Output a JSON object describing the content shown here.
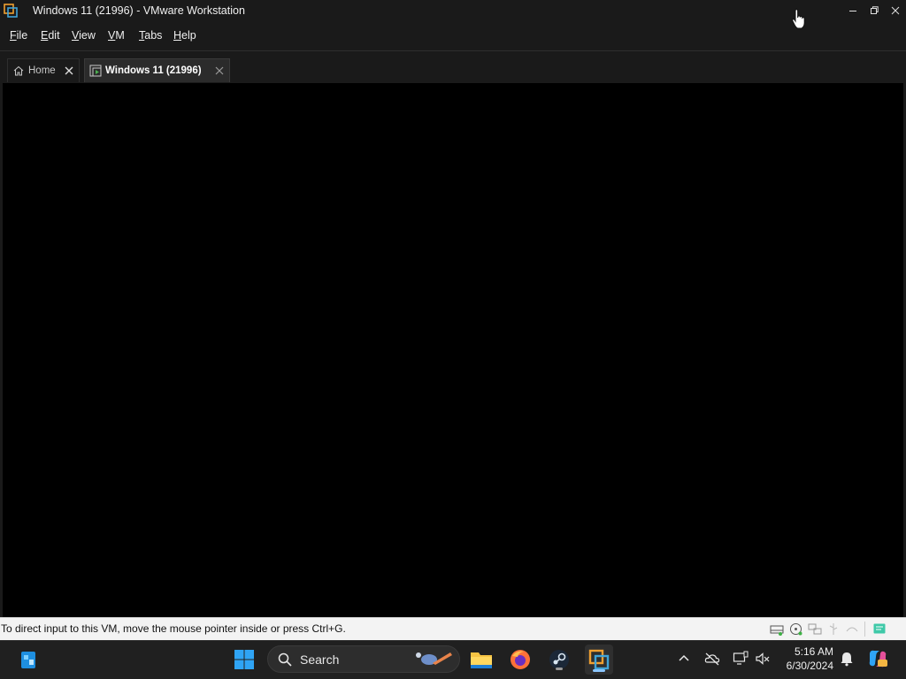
{
  "window": {
    "title": "Windows 11 (21996) - VMware Workstation"
  },
  "menu": {
    "items": [
      "File",
      "Edit",
      "View",
      "VM",
      "Tabs",
      "Help"
    ]
  },
  "tabs": [
    {
      "label": "Home",
      "active": false,
      "icon": "home-icon"
    },
    {
      "label": "Windows 11 (21996)",
      "active": true,
      "icon": "vm-icon"
    }
  ],
  "status": {
    "message": "To direct input to this VM, move the mouse pointer inside or press Ctrl+G.",
    "icons": [
      "hard-disk-icon",
      "cd-rom-icon",
      "network-icon",
      "usb-icon",
      "sound-icon",
      "message-icon"
    ]
  },
  "taskbar": {
    "search_placeholder": "Search",
    "pinned": [
      "start-icon",
      "search-icon",
      "file-explorer-icon",
      "firefox-icon",
      "steam-icon",
      "vmware-icon"
    ],
    "tray": [
      "chevron-up-icon",
      "onedrive-icon",
      "display-icon",
      "volume-icon"
    ],
    "time": "5:16 AM",
    "date": "6/30/2024"
  },
  "colors": {
    "titlebar_bg": "#1a1a1a",
    "statusbar_bg": "#f3f3f3",
    "taskbar_bg": "#202020",
    "vm_bg": "#000000",
    "accent": "#8bc6ff"
  }
}
